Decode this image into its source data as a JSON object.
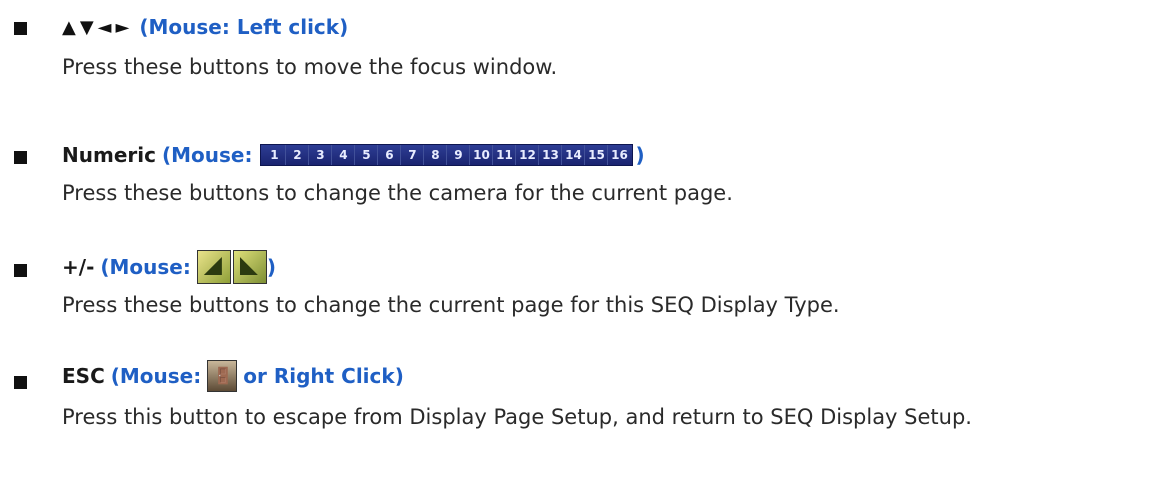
{
  "items": [
    {
      "arrows": "▲▼◄►",
      "mouse": "(Mouse: Left click)",
      "desc": "Press these buttons to move the focus window."
    },
    {
      "label": "Numeric",
      "mouse_open": "(Mouse:",
      "mouse_close": ")",
      "numbers": [
        "1",
        "2",
        "3",
        "4",
        "5",
        "6",
        "7",
        "8",
        "9",
        "10",
        "11",
        "12",
        "13",
        "14",
        "15",
        "16"
      ],
      "desc": "Press these buttons to change the camera for the current page."
    },
    {
      "label": "+/-",
      "mouse_open": "(Mouse:",
      "mouse_close": ")",
      "desc": "Press these buttons to change the current page for this SEQ Display Type."
    },
    {
      "label": "ESC",
      "mouse_open": "(Mouse:",
      "mouse_close": "or Right Click)",
      "desc": "Press this button to escape from Display Page Setup, and return to SEQ Display Setup."
    }
  ],
  "colors": {
    "accent": "#1f5fc4",
    "text": "#2a2a2a",
    "strip": "#1a2470"
  }
}
